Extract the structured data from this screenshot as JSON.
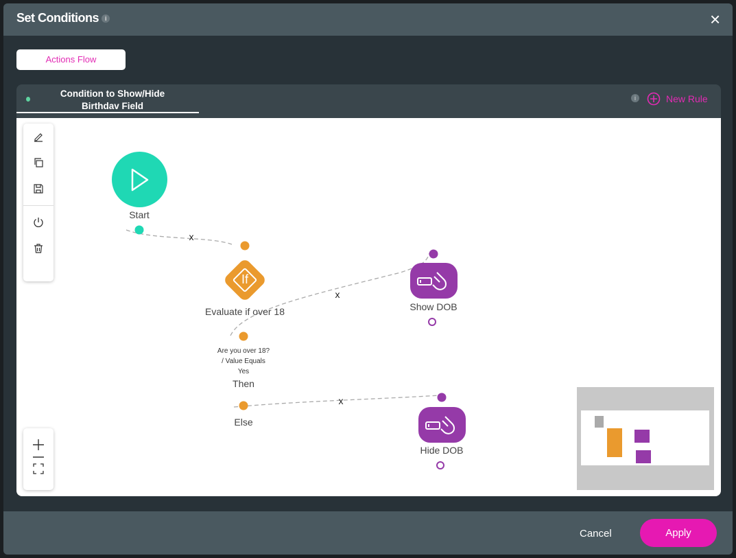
{
  "dialog": {
    "title": "Set Conditions",
    "info": "i",
    "close": "×"
  },
  "actions_flow_label": "Actions Flow",
  "tab": {
    "label": "Condition to Show/Hide Birthdav Field",
    "info": "i",
    "new_rule": "New Rule"
  },
  "nodes": {
    "start": "Start",
    "evaluate": "Evaluate if over 18",
    "if_glyph": "If",
    "condition": [
      "Are you over 18?",
      "/ Value Equals",
      "Yes"
    ],
    "then": "Then",
    "else": "Else",
    "show": "Show DOB",
    "hide": "Hide DOB",
    "edge_x": "x"
  },
  "toolbar": [
    "edit-icon",
    "copy-icon",
    "save-icon",
    "power-icon",
    "trash-icon"
  ],
  "zoom": [
    "plus-icon",
    "minus-icon",
    "fit-screen-icon"
  ],
  "footer": {
    "cancel": "Cancel",
    "apply": "Apply"
  },
  "colors": {
    "accent": "#e619b2",
    "start": "#1fd8b4",
    "condition": "#ea9a2e",
    "action": "#953aa8"
  }
}
